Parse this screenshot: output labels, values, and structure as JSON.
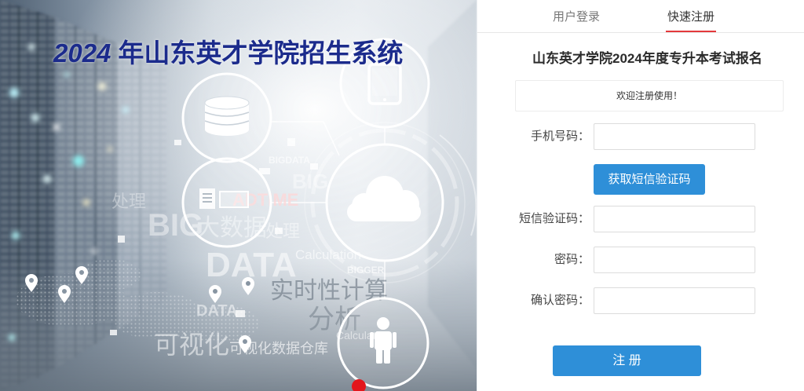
{
  "banner": {
    "title_year": "2024",
    "title_rest": "年山东英才学院招生系统",
    "words": [
      "BIG",
      "大数据",
      "处理",
      "ADTIME",
      "BIG",
      "DATA",
      "Calculation",
      "BIGGER",
      "实时性计算",
      "分析",
      "可视化",
      "可视化数据仓库",
      "DATA",
      "Calculation",
      "BIGDATA",
      "处理"
    ],
    "icons": [
      "database-icon",
      "tablet-icon",
      "document-icon",
      "cloud-icon",
      "person-icon",
      "map-pin-icon"
    ]
  },
  "tabs": [
    {
      "label": "用户登录",
      "active": false
    },
    {
      "label": "快速注册",
      "active": true
    }
  ],
  "form": {
    "title": "山东英才学院2024年度专升本考试报名",
    "notice": "欢迎注册使用！",
    "phone": {
      "label": "手机号码：",
      "value": ""
    },
    "get_code_button": "获取短信验证码",
    "sms_code": {
      "label": "短信验证码：",
      "value": ""
    },
    "password": {
      "label": "密码：",
      "value": ""
    },
    "confirm_password": {
      "label": "确认密码：",
      "value": ""
    },
    "submit_button": "注 册"
  },
  "colors": {
    "banner_title": "#1b2b8c",
    "primary_button": "#2e8fd8",
    "active_tab_underline": "#e4393c",
    "marker": "#e3161b"
  }
}
